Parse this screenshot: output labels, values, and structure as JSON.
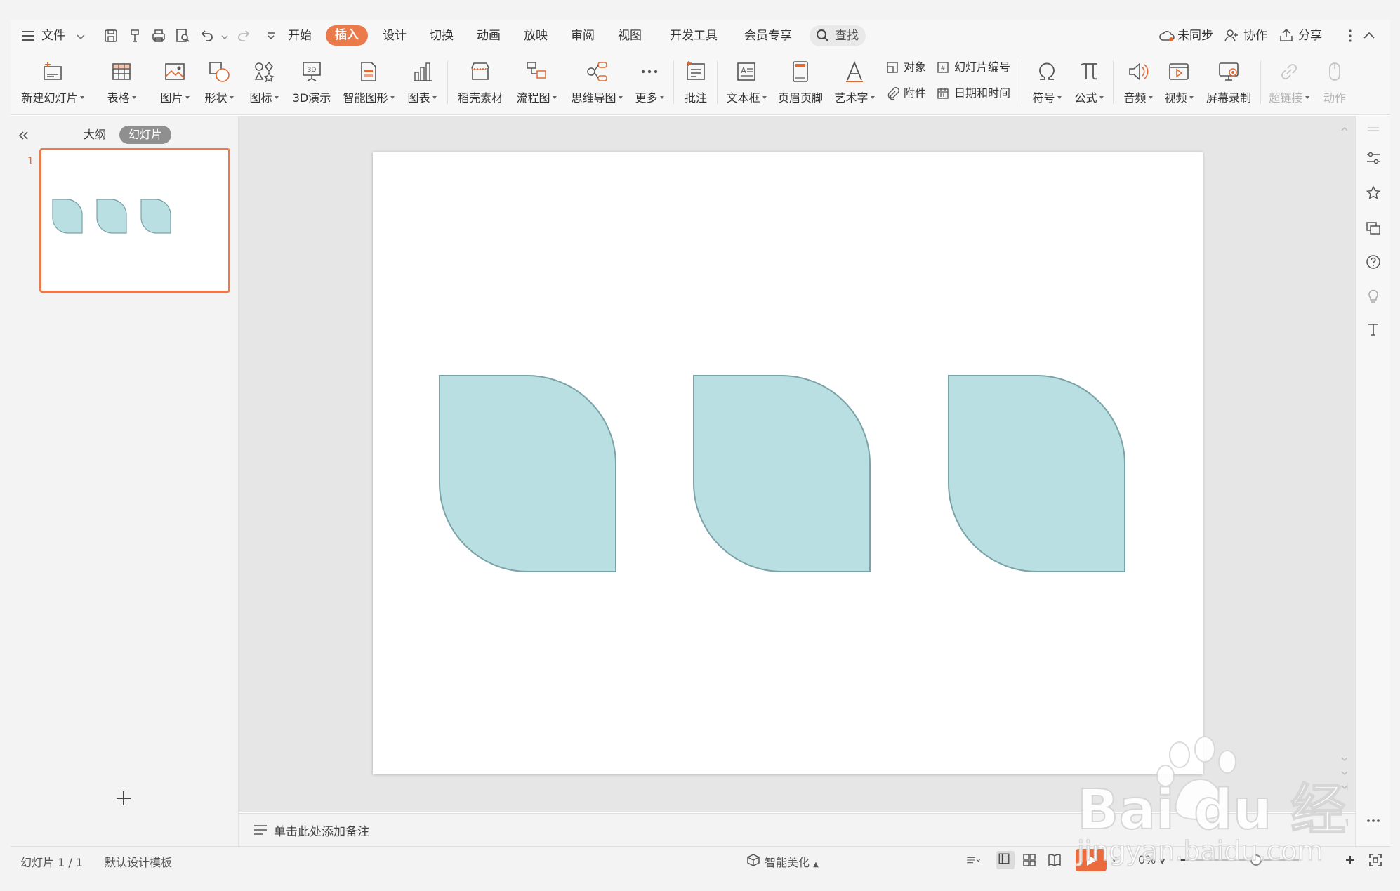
{
  "menubar": {
    "file_label": "文件",
    "tabs": [
      "开始",
      "插入",
      "设计",
      "切换",
      "动画",
      "放映",
      "审阅",
      "视图",
      "开发工具",
      "会员专享"
    ],
    "active_tab": "插入",
    "search_label": "查找",
    "sync_label": "未同步",
    "collab_label": "协作",
    "share_label": "分享"
  },
  "ribbon": {
    "buttons": [
      "新建幻灯片",
      "表格",
      "图片",
      "形状",
      "图标",
      "3D演示",
      "智能图形",
      "图表",
      "稻壳素材",
      "流程图",
      "思维导图",
      "更多",
      "批注",
      "文本框",
      "页眉页脚",
      "艺术字",
      "符号",
      "公式",
      "音频",
      "视频",
      "屏幕录制",
      "超链接",
      "动作"
    ],
    "small": {
      "object": "对象",
      "slide_number": "幻灯片编号",
      "attachment": "附件",
      "datetime": "日期和时间"
    }
  },
  "panel": {
    "outline_tab": "大纲",
    "slides_tab": "幻灯片",
    "slide_number": "1"
  },
  "notes": {
    "placeholder": "单击此处添加备注"
  },
  "status": {
    "slide_indicator": "幻灯片 1 / 1",
    "template": "默认设计模板",
    "beautify": "智能美化",
    "zoom": "0%"
  },
  "watermark": {
    "brand": "Bai du 经验",
    "url": "jingyan.baidu.com"
  },
  "colors": {
    "accent": "#ea7a49",
    "shape_fill": "#b9dfe2",
    "shape_stroke": "#7aa3a7"
  }
}
